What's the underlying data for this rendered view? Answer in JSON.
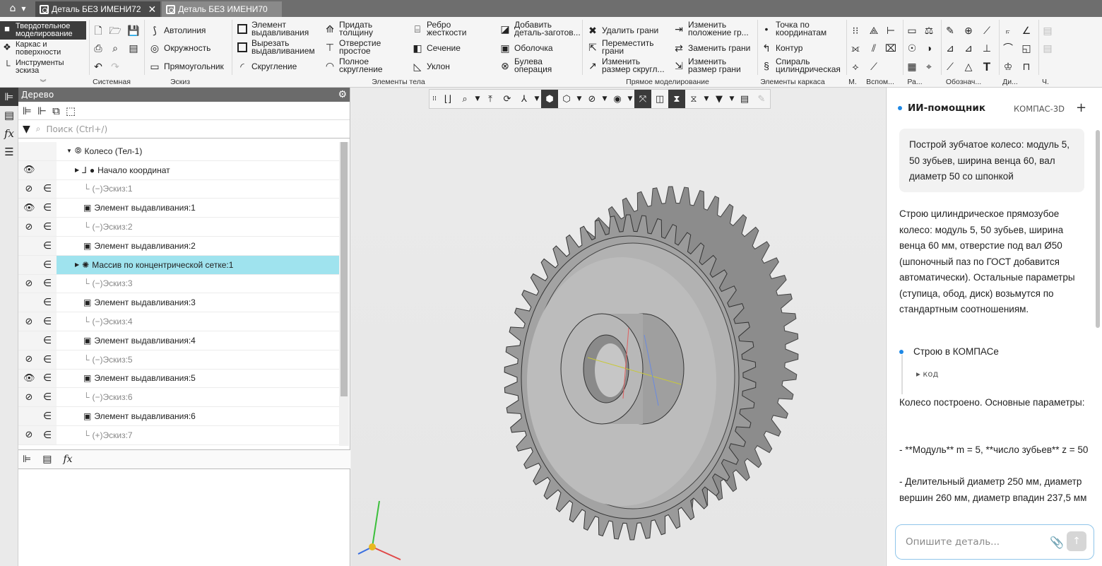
{
  "tabs": [
    {
      "label": "Деталь БЕЗ ИМЕНИ72"
    },
    {
      "label": "Деталь БЕЗ ИМЕНИ70"
    }
  ],
  "modes": [
    {
      "label": "Твердотельное моделирование"
    },
    {
      "label": "Каркас и поверхности"
    },
    {
      "label": "Инструменты эскиза"
    }
  ],
  "ribbon": {
    "sketch": [
      "Автолиния",
      "Окружность",
      "Прямоугольник"
    ],
    "body": [
      "Элемент выдавливания",
      "Вырезать выдавливанием",
      "Скругление",
      "Придать толщину",
      "Отверстие простое",
      "Полное скругление",
      "Ребро жесткости",
      "Сечение",
      "Уклон",
      "Добавить деталь-заготов...",
      "Оболочка",
      "Булева операция"
    ],
    "direct": [
      "Удалить грани",
      "Переместить грани",
      "Изменить размер скругл...",
      "Изменить положение гр...",
      "Заменить грани",
      "Изменить размер грани"
    ],
    "frame": [
      "Точка по координатам",
      "Контур",
      "Спираль цилиндрическая"
    ],
    "groups": [
      "Системная",
      "Эскиз",
      "Элементы тела",
      "Прямое моделирование",
      "Элементы каркаса",
      "М.",
      "Вспом...",
      "Ра...",
      "Обознач...",
      "Ди...",
      "Ч."
    ]
  },
  "tree": {
    "title": "Дерево",
    "search_placeholder": "Поиск (Ctrl+/)",
    "items": [
      {
        "label": "Колесо (Тел-1)"
      },
      {
        "label": "Начало координат"
      },
      {
        "label": "(−)Эскиз:1"
      },
      {
        "label": "Элемент выдавливания:1"
      },
      {
        "label": "(−)Эскиз:2"
      },
      {
        "label": "Элемент выдавливания:2"
      },
      {
        "label": "Массив по концентрической сетке:1"
      },
      {
        "label": "(−)Эскиз:3"
      },
      {
        "label": "Элемент выдавливания:3"
      },
      {
        "label": "(−)Эскиз:4"
      },
      {
        "label": "Элемент выдавливания:4"
      },
      {
        "label": "(−)Эскиз:5"
      },
      {
        "label": "Элемент выдавливания:5"
      },
      {
        "label": "(−)Эскиз:6"
      },
      {
        "label": "Элемент выдавливания:6"
      },
      {
        "label": "(+)Эскиз:7"
      }
    ]
  },
  "ai": {
    "title": "ИИ-помощник",
    "subtitle": "КОМПАС-3D",
    "user_msg": "Построй зубчатое колесо: модуль 5, 50 зубьев, ширина венца 60, вал диаметр 50 со шпонкой",
    "reply": "Строю цилиндрическое прямозубое колесо: модуль 5, 50 зубьев, ширина венца 60 мм, отверстие под вал Ø50 (шпоночный паз по ГОСТ добавится автоматически). Остальные параметры (ступица, обод, диск) возьмутся по стандартным соотношениям.",
    "step": "Строю в КОМПАСе",
    "code": "▸ код",
    "done": "Колесо построено. Основные параметры:",
    "p1": "- **Модуль** m = 5, **число зубьев** z = 50",
    "p2": "- Делительный диаметр 250 мм, диаметр вершин 260 мм, диаметр впадин 237,5 мм",
    "input_placeholder": "Опишите деталь..."
  },
  "colors": {
    "selection": "#9fe3ee",
    "accent": "#1e88e5"
  }
}
